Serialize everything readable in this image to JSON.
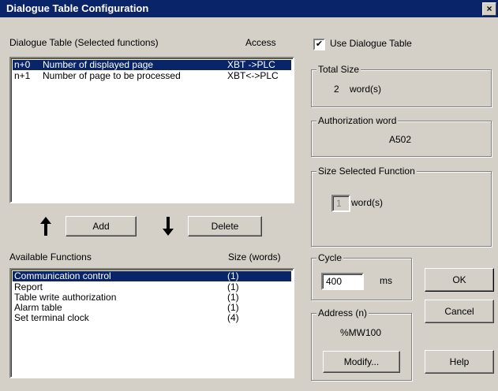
{
  "window": {
    "title": "Dialogue Table Configuration",
    "close_symbol": "×"
  },
  "dialogue_table": {
    "label": "Dialogue Table (Selected functions)",
    "access_header": "Access",
    "rows": [
      {
        "offset": "n+0",
        "name": "Number of displayed page",
        "access": "XBT ->PLC"
      },
      {
        "offset": "n+1",
        "name": "Number of page to be processed",
        "access": "XBT<->PLC"
      }
    ]
  },
  "buttons": {
    "add": "Add",
    "delete": "Delete",
    "ok": "OK",
    "cancel": "Cancel",
    "help": "Help",
    "modify": "Modify..."
  },
  "icons": {
    "add": "arrow-up-icon",
    "delete": "arrow-down-icon"
  },
  "available": {
    "label": "Available Functions",
    "size_header": "Size (words)",
    "rows": [
      {
        "name": "Communication control",
        "size": "(1)"
      },
      {
        "name": "Report",
        "size": "(1)"
      },
      {
        "name": "Table write authorization",
        "size": "(1)"
      },
      {
        "name": "Alarm table",
        "size": "(1)"
      },
      {
        "name": "Set terminal clock",
        "size": "(4)"
      }
    ]
  },
  "use_dialogue_table": {
    "label": "Use Dialogue Table",
    "checked": true
  },
  "total_size": {
    "label": "Total Size",
    "value": "2",
    "unit": "word(s)"
  },
  "authorization": {
    "label": "Authorization word",
    "value": "A502"
  },
  "size_selected": {
    "label": "Size Selected Function",
    "value": "1",
    "unit": "word(s)"
  },
  "cycle": {
    "label": "Cycle",
    "value": "400",
    "unit": "ms"
  },
  "address": {
    "label": "Address (n)",
    "value": "%MW100"
  }
}
